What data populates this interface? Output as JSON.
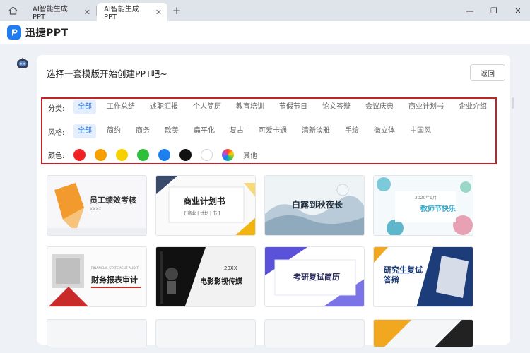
{
  "tabs": [
    {
      "label": "AI智能生成PPT",
      "active": false
    },
    {
      "label": "AI智能生成PPT",
      "active": true
    }
  ],
  "window": {
    "minimize": "—",
    "maximize": "❐",
    "close": "✕",
    "new_tab": "+",
    "tab_close": "✕"
  },
  "app": {
    "name": "迅捷PPT",
    "accent": "#1f7cf2"
  },
  "main": {
    "prompt": "选择一套模版开始创建PPT吧~",
    "back_label": "返回"
  },
  "filters": {
    "category": {
      "label": "分类:",
      "options": [
        "全部",
        "工作总结",
        "述职汇报",
        "个人简历",
        "教育培训",
        "节假节日",
        "论文答辩",
        "会议庆典",
        "商业计划书",
        "企业介绍"
      ],
      "selected": 0
    },
    "style": {
      "label": "风格:",
      "options": [
        "全部",
        "简约",
        "商务",
        "欧美",
        "扁平化",
        "复古",
        "可爱卡通",
        "清新淡雅",
        "手绘",
        "微立体",
        "中国风"
      ],
      "selected": 0
    },
    "color": {
      "label": "颜色:",
      "swatches": [
        "#ee2222",
        "#f5a000",
        "#f7d000",
        "#2fbf3a",
        "#1d80ef",
        "#111111",
        "#ffffff",
        "rainbow"
      ],
      "other_label": "其他"
    }
  },
  "templates": [
    {
      "title": "员工绩效考核",
      "accent": "#f29a2e"
    },
    {
      "title": "商业计划书",
      "accent": "#f2b40e"
    },
    {
      "title": "白露到秋夜长",
      "accent": "#6f8fa8"
    },
    {
      "title": "教师节快乐",
      "accent": "#3aa8c8"
    },
    {
      "title": "财务报表审计",
      "accent": "#c92a2a"
    },
    {
      "title": "电影影视传媒",
      "accent": "#111111"
    },
    {
      "title": "考研复试简历",
      "accent": "#5a52d8"
    },
    {
      "title": "研究生复试答辩",
      "accent": "#1d3d7a"
    }
  ],
  "thumb_texts": {
    "year_20xx": "20XX",
    "perf_sub": "XXXX",
    "bp_sub": "[ 商业 | 计划 | 书 ]",
    "fin_sub": "FINANCIAL STATEMENT AUDIT",
    "teach_tag": "2020年9月"
  }
}
